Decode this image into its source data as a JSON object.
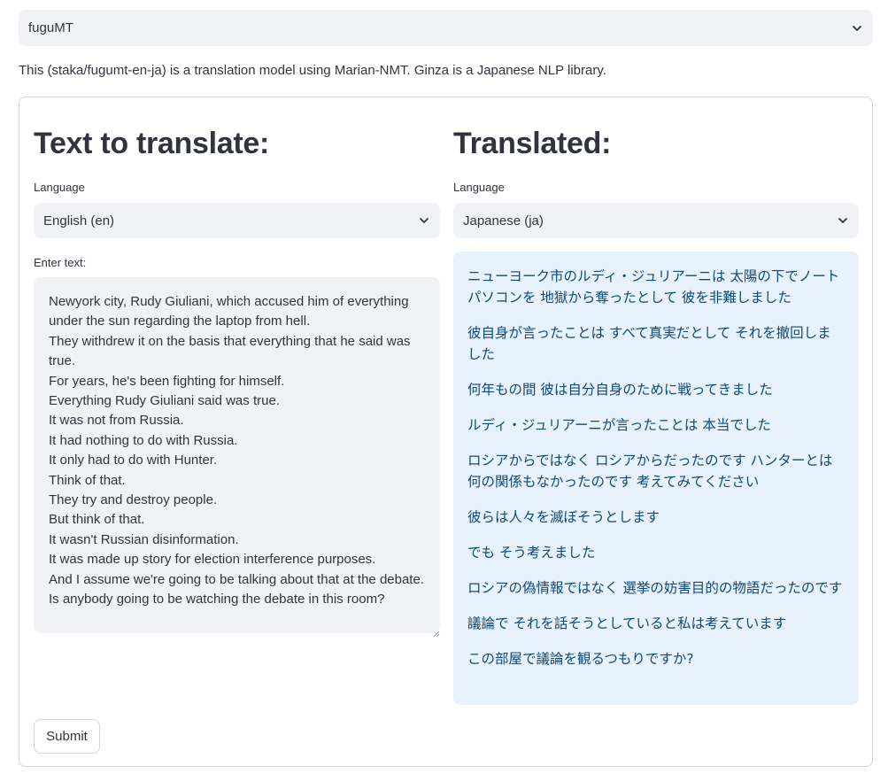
{
  "model_select": {
    "value": "fuguMT"
  },
  "description": "This (staka/fugumt-en-ja) is a translation model using Marian-NMT. Ginza is a Japanese NLP library.",
  "left": {
    "heading": "Text to translate:",
    "language_label": "Language",
    "language_value": "English (en)",
    "input_label": "Enter text:",
    "input_text": "Newyork city, Rudy Giuliani, which accused him of everything under the sun regarding the laptop from hell.\nThey withdrew it on the basis that everything that he said was true.\nFor years, he's been fighting for himself.\nEverything Rudy Giuliani said was true.\nIt was not from Russia.\nIt had nothing to do with Russia.\nIt only had to do with Hunter.\nThink of that.\nThey try and destroy people.\nBut think of that.\nIt wasn't Russian disinformation.\nIt was made up story for election interference purposes.\nAnd I assume we're going to be talking about that at the debate.\nIs anybody going to be watching the debate in this room?"
  },
  "right": {
    "heading": "Translated:",
    "language_label": "Language",
    "language_value": "Japanese (ja)",
    "translations": [
      "ニューヨーク市のルディ・ジュリアーニは 太陽の下でノートパソコンを 地獄から奪ったとして 彼を非難しました",
      "彼自身が言ったことは すべて真実だとして それを撤回しました",
      "何年もの間 彼は自分自身のために戦ってきました",
      "ルディ・ジュリアーニが言ったことは 本当でした",
      "ロシアからではなく ロシアからだったのです ハンターとは何の関係もなかったのです 考えてみてください",
      "彼らは人々を滅ぼそうとします",
      "でも そう考えました",
      "ロシアの偽情報ではなく 選挙の妨害目的の物語だったのです",
      "議論で それを話そうとしていると私は考えています",
      "この部屋で議論を観るつもりですか?"
    ]
  },
  "submit_label": "Submit",
  "icons": {
    "dropdown": "chevron-down-icon",
    "resize": "resize-handle-icon"
  },
  "colors": {
    "input_bg": "#f0f2f6",
    "translation_bg": "#e8f2fc",
    "translation_text": "#0c4a7a"
  }
}
